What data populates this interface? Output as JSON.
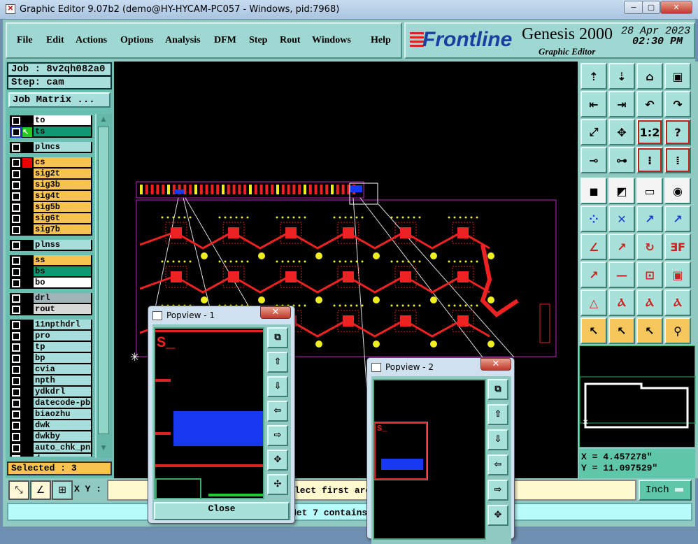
{
  "window": {
    "title": "Graphic Editor 9.07b2 (demo@HY-HYCAM-PC057 - Windows, pid:7968)",
    "min": "−",
    "max": "▢",
    "close": "✕"
  },
  "menu": [
    {
      "label": "File"
    },
    {
      "label": "Edit"
    },
    {
      "label": "Actions"
    },
    {
      "label": "Options"
    },
    {
      "label": "Analysis"
    },
    {
      "label": "DFM"
    },
    {
      "label": "Step"
    },
    {
      "label": "Rout"
    },
    {
      "label": "Windows"
    },
    {
      "label": "Help"
    }
  ],
  "logo": {
    "brand": "Frontline",
    "product": "Genesis 2000",
    "subtitle": "Graphic Editor",
    "date": "28 Apr 2023",
    "time": "02:30 PM"
  },
  "job": {
    "job_label": "Job : 8v2qh082a0",
    "step_label": "Step: cam",
    "matrix_button": "Job Matrix ..."
  },
  "layers": [
    {
      "name": "to",
      "color": "#ffffff",
      "group": 0
    },
    {
      "name": "ts",
      "color": "#0f9a73",
      "group": 0,
      "marker": "work",
      "selected": true
    },
    {
      "name": "plncs",
      "color": "#a7dedb",
      "group": 1
    },
    {
      "name": "cs",
      "color": "#f9c34f",
      "group": 2,
      "marker": "red"
    },
    {
      "name": "sig2t",
      "color": "#f9c34f",
      "group": 2
    },
    {
      "name": "sig3b",
      "color": "#f9c34f",
      "group": 2
    },
    {
      "name": "sig4t",
      "color": "#f9c34f",
      "group": 2
    },
    {
      "name": "sig5b",
      "color": "#f9c34f",
      "group": 2
    },
    {
      "name": "sig6t",
      "color": "#f9c34f",
      "group": 2
    },
    {
      "name": "sig7b",
      "color": "#f9c34f",
      "group": 2
    },
    {
      "name": "plnss",
      "color": "#a7dedb",
      "group": 3
    },
    {
      "name": "ss",
      "color": "#f9c34f",
      "group": 4
    },
    {
      "name": "bs",
      "color": "#0f9a73",
      "group": 4
    },
    {
      "name": "bo",
      "color": "#ffffff",
      "group": 4
    },
    {
      "name": "drl",
      "color": "#9fb5b8",
      "group": 5
    },
    {
      "name": "rout",
      "color": "#d8d8d8",
      "group": 5
    },
    {
      "name": "11npthdrl",
      "color": "#a7dedb",
      "group": 6
    },
    {
      "name": "pro",
      "color": "#a7dedb",
      "group": 6
    },
    {
      "name": "tp",
      "color": "#a7dedb",
      "group": 6
    },
    {
      "name": "bp",
      "color": "#a7dedb",
      "group": 6
    },
    {
      "name": "cvia",
      "color": "#a7dedb",
      "group": 6
    },
    {
      "name": "npth",
      "color": "#a7dedb",
      "group": 6
    },
    {
      "name": "ydkdrl",
      "color": "#a7dedb",
      "group": 6
    },
    {
      "name": "datecode-pbe",
      "color": "#a7dedb",
      "group": 6
    },
    {
      "name": "biaozhu",
      "color": "#a7dedb",
      "group": 6
    },
    {
      "name": "dwk",
      "color": "#a7dedb",
      "group": 6
    },
    {
      "name": "dwkby",
      "color": "#a7dedb",
      "group": 6
    },
    {
      "name": "auto_chk_pnl",
      "color": "#a7dedb",
      "group": 6
    },
    {
      "name": "d",
      "color": "#a7dedb",
      "group": 6
    }
  ],
  "selected_label": "Selected : 3",
  "coords": {
    "x": "X = 4.457278\"",
    "y": "Y = 11.097529\""
  },
  "bottom": {
    "xy_label": "X Y :",
    "input_value": "lect first are",
    "unit": "Inch",
    "status": "Net 7 contains"
  },
  "popview1": {
    "title": "Popview - 1",
    "close_label": "Close",
    "text": "S_"
  },
  "popview2": {
    "title": "Popview - 2",
    "text": "S_"
  },
  "toolbox_icons": [
    "move-up",
    "move-down",
    "home",
    "zoom-window",
    "pan-left",
    "pan-right",
    "undo-view",
    "redo-view",
    "fit-all",
    "fit-profile",
    "one-to-one",
    "help",
    "measure",
    "probe",
    "layer-snap-a",
    "layer-snap-b",
    "pad",
    "slot",
    "ruler",
    "donut",
    "net-select",
    "feature-x",
    "add-point",
    "line-add",
    "pen-red",
    "pen-blue",
    "rotate",
    "mirror-ff",
    "point-select",
    "line-select",
    "scale",
    "box",
    "triangle-a",
    "triangle-b",
    "triangle-c",
    "triangle-d",
    "arrow",
    "arrow-frame",
    "arrow-circle",
    "pick-net"
  ],
  "colors": {
    "accent": "#8fc9c2",
    "copper": "#ff1a1a",
    "pad": "#ffff00",
    "outline": "#c020c0"
  }
}
